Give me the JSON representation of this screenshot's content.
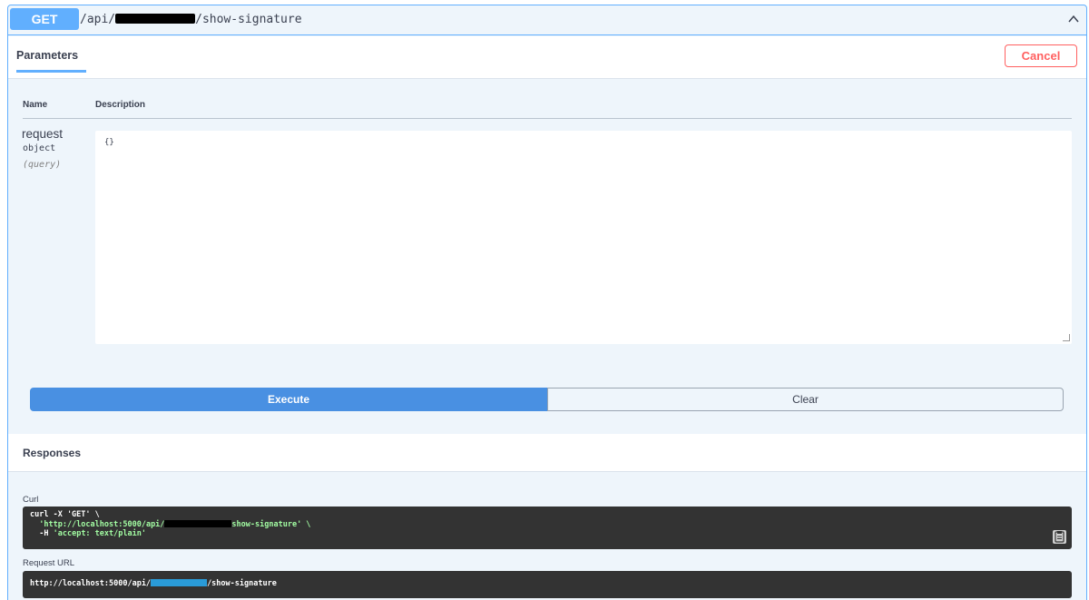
{
  "endpoint": {
    "method": "GET",
    "path_prefix": "/api/",
    "path_suffix": "/show-signature"
  },
  "tabs": {
    "parameters": "Parameters",
    "cancel": "Cancel"
  },
  "params_table": {
    "col_name": "Name",
    "col_description": "Description",
    "rows": [
      {
        "name": "request",
        "type": "object",
        "in": "(query)",
        "value": "{}"
      }
    ]
  },
  "actions": {
    "execute": "Execute",
    "clear": "Clear"
  },
  "responses": {
    "title": "Responses",
    "curl_label": "Curl",
    "curl": {
      "line1": "curl -X 'GET' \\",
      "line2_prefix": "'http://localhost:5000/api/",
      "line2_suffix": "show-signature' \\",
      "line3_flag": "-H ",
      "line3_value": "'accept: text/plain'"
    },
    "request_url_label": "Request URL",
    "request_url_prefix": "http://localhost:5000/api/",
    "request_url_suffix": "/show-signature"
  },
  "colors": {
    "get": "#61affe",
    "execute": "#4990e2",
    "cancel": "#ff6060",
    "code_bg": "#333333"
  }
}
